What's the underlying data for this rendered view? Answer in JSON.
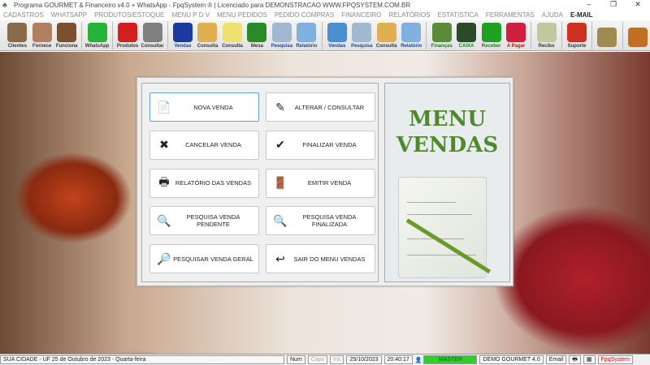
{
  "title": "Programa GOURMET & Financeiro v4.0 + WhatsApp - FpqSystem ® | Licenciado para  DEMONSTRACAO WWW.FPQSYSTEM.COM.BR",
  "window_controls": [
    "–",
    "❐",
    "✕"
  ],
  "menu": [
    "CADASTROS",
    "WHATSAPP",
    "PRODUTOS/ESTOQUE",
    "MENU P D V",
    "MENU PEDIDOS",
    "PEDIDO COMPRAS",
    "FINANCEIRO",
    "RELATÓRIOS",
    "ESTATISTICA",
    "FERRAMENTAS",
    "AJUDA"
  ],
  "menu_email": "E-MAIL",
  "toolbar": [
    {
      "label": "Clientes",
      "color": "#8a6a4a",
      "style": ""
    },
    {
      "label": "Fornece",
      "color": "#b08060",
      "style": ""
    },
    {
      "label": "Funciona",
      "color": "#7a5030",
      "style": ""
    },
    {
      "sep": true
    },
    {
      "label": "WhatsApp",
      "color": "#25b33a",
      "style": ""
    },
    {
      "sep": true
    },
    {
      "label": "Produtos",
      "color": "#d02020",
      "style": ""
    },
    {
      "label": "Consultar",
      "color": "#808080",
      "style": ""
    },
    {
      "sep": true
    },
    {
      "label": "Vendas",
      "color": "#1a3aa0",
      "style": "blue"
    },
    {
      "label": "Consulta",
      "color": "#e0b050",
      "style": ""
    },
    {
      "label": "Consulta",
      "color": "#f0e070",
      "style": ""
    },
    {
      "label": "Mesa",
      "color": "#2a8a2a",
      "style": ""
    },
    {
      "label": "Pesquisa",
      "color": "#a0b8d0",
      "style": "blue"
    },
    {
      "label": "Relatório",
      "color": "#80b0e0",
      "style": "blue"
    },
    {
      "sep": true
    },
    {
      "label": "Vendas",
      "color": "#4a90d0",
      "style": "blue"
    },
    {
      "label": "Pesquisa",
      "color": "#a0b8d0",
      "style": "blue"
    },
    {
      "label": "Consulta",
      "color": "#e0b050",
      "style": ""
    },
    {
      "label": "Relatório",
      "color": "#80b0e0",
      "style": "blue"
    },
    {
      "sep": true
    },
    {
      "label": "Finanças",
      "color": "#5a8a3a",
      "style": "green"
    },
    {
      "label": "CAIXA",
      "color": "#2a4a2a",
      "style": "green"
    },
    {
      "label": "Receber",
      "color": "#1fa01f",
      "style": "green"
    },
    {
      "label": "A Pagar",
      "color": "#d02040",
      "style": "red"
    },
    {
      "sep": true
    },
    {
      "label": "Recibo",
      "color": "#c0c8a0",
      "style": ""
    },
    {
      "sep": true
    },
    {
      "label": "Suporte",
      "color": "#d03020",
      "style": ""
    },
    {
      "sep": true
    },
    {
      "label": "",
      "color": "#a08a50",
      "style": ""
    },
    {
      "sep": true
    },
    {
      "label": "",
      "color": "#c07020",
      "style": ""
    }
  ],
  "buttons": [
    {
      "label": "NOVA VENDA",
      "icon": "new-doc-icon",
      "glyph": "📄"
    },
    {
      "label": "ALTERAR / CONSULTAR",
      "icon": "pencil-icon",
      "glyph": "✎"
    },
    {
      "label": "CANCELAR VENDA",
      "icon": "cancel-doc-icon",
      "glyph": "✖"
    },
    {
      "label": "FINALIZAR VENDA",
      "icon": "check-doc-icon",
      "glyph": "✔"
    },
    {
      "label": "RELATÓRIO DAS VENDAS",
      "icon": "printer-icon",
      "glyph": "🖶"
    },
    {
      "label": "EMITIR VENDA",
      "icon": "person-door-icon",
      "glyph": "🚪"
    },
    {
      "label": "PESQUISA VENDA PENDENTE",
      "icon": "search-chart-icon",
      "glyph": "🔍"
    },
    {
      "label": "PESQUISA VENDA FINALIZADA",
      "icon": "search-chart-icon",
      "glyph": "🔍"
    },
    {
      "label": "PESQUISAR VENDA GERAL",
      "icon": "magnifier-icon",
      "glyph": "🔎"
    },
    {
      "label": "SAIR DO MENU VENDAS",
      "icon": "exit-doc-icon",
      "glyph": "↩"
    }
  ],
  "side_title_line1": "MENU",
  "side_title_line2": "VENDAS",
  "status": {
    "city": "SUA CIDADE - UF 25 de Outubro de 2023 - Quarta-feira",
    "num": "Num",
    "caps": "Caps",
    "ins": "Ins",
    "date": "25/10/2023",
    "time": "20:40:17",
    "user": "MASTER",
    "company": "DEMO GOURMET 4.0",
    "email": "Email",
    "brand": "FpqSystem"
  }
}
